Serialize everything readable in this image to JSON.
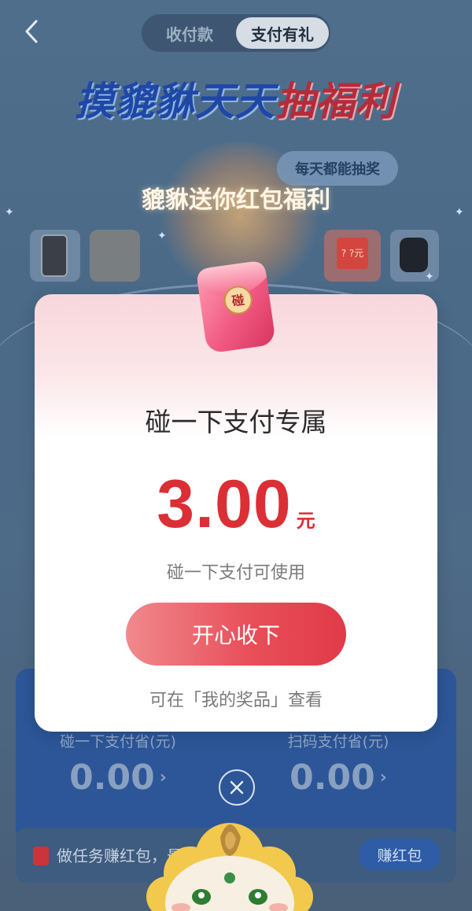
{
  "header": {
    "tabs": [
      {
        "label": "收付款"
      },
      {
        "label": "支付有礼"
      }
    ]
  },
  "banner": {
    "title_part1": "摸貔貅",
    "title_part2": "天天",
    "title_part3": "抽福利",
    "daily_badge": "每天都能抽奖",
    "gift_title": "貔貅送你红包福利"
  },
  "prizes": {
    "box_label": "? ?元"
  },
  "envelope": {
    "seal_text": "碰"
  },
  "modal": {
    "title": "碰一下支付专属",
    "amount": "3.00",
    "unit": "元",
    "usage_note": "碰一下支付可使用",
    "accept_button": "开心收下",
    "view_note": "可在「我的奖品」查看"
  },
  "savings": {
    "left_label": "碰一下支付省(元)",
    "left_value": "0.00",
    "right_label": "扫码支付省(元)",
    "right_value": "0.00"
  },
  "task": {
    "text": "做任务赚红包，最",
    "button": "赚红包"
  },
  "colors": {
    "accent_red": "#db2f35",
    "button_gradient_start": "#f0898e",
    "button_gradient_end": "#e03a48",
    "card_blue": "#2c5697"
  }
}
